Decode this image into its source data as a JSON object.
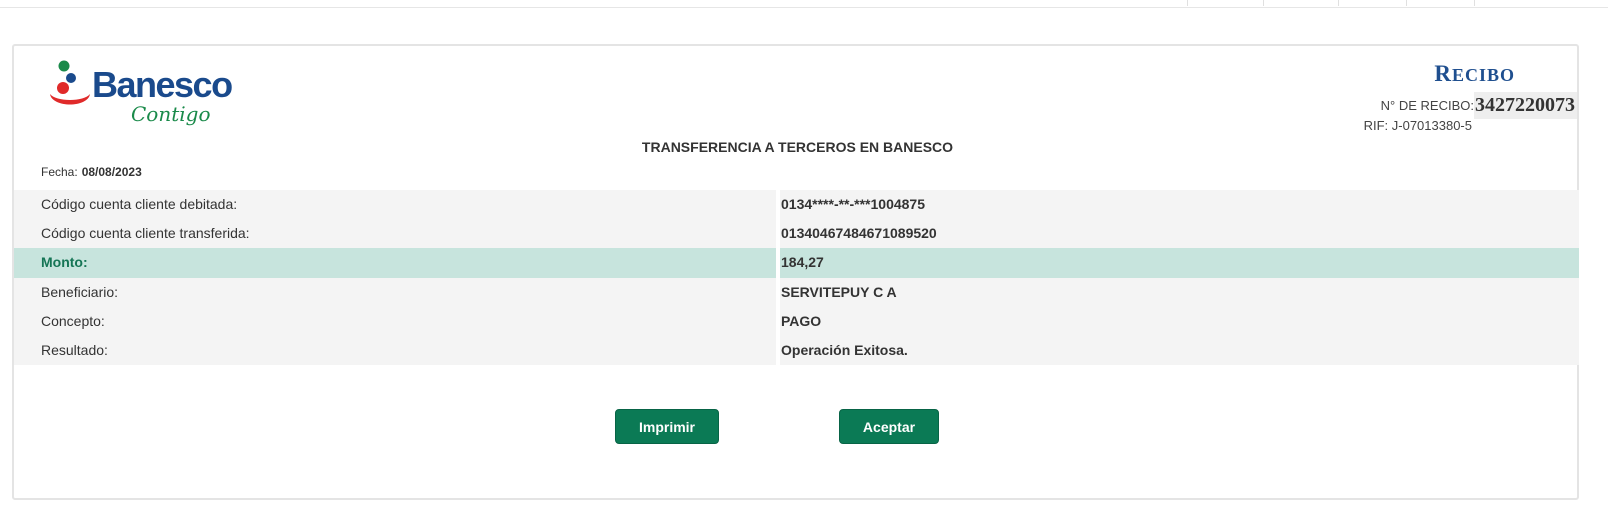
{
  "brand": {
    "name": "Banesco",
    "tagline": "Contigo"
  },
  "receipt": {
    "title_prefix": "R",
    "title_rest": "ECIBO",
    "number_label": "N° DE RECIBO:",
    "number": "3427220073",
    "rif": "RIF: J-07013380-5"
  },
  "heading": "TRANSFERENCIA A TERCEROS EN BANESCO",
  "date": {
    "label": "Fecha:",
    "value": "08/08/2023"
  },
  "rows": [
    {
      "label": "Código cuenta cliente debitada:",
      "value": "0134****-**-***1004875"
    },
    {
      "label": "Código cuenta cliente transferida:",
      "value": "01340467484671089520"
    },
    {
      "label": "Monto:",
      "value": "184,27"
    },
    {
      "label": "Beneficiario:",
      "value": "SERVITEPUY C A"
    },
    {
      "label": "Concepto:",
      "value": "PAGO"
    },
    {
      "label": "Resultado:",
      "value": "Operación Exitosa."
    }
  ],
  "buttons": {
    "print": "Imprimir",
    "accept": "Aceptar"
  },
  "colors": {
    "brand_blue": "#1a4a8c",
    "brand_green": "#0b7a55",
    "logo_red": "#e02a2a",
    "highlight_row": "#c7e4dd"
  }
}
